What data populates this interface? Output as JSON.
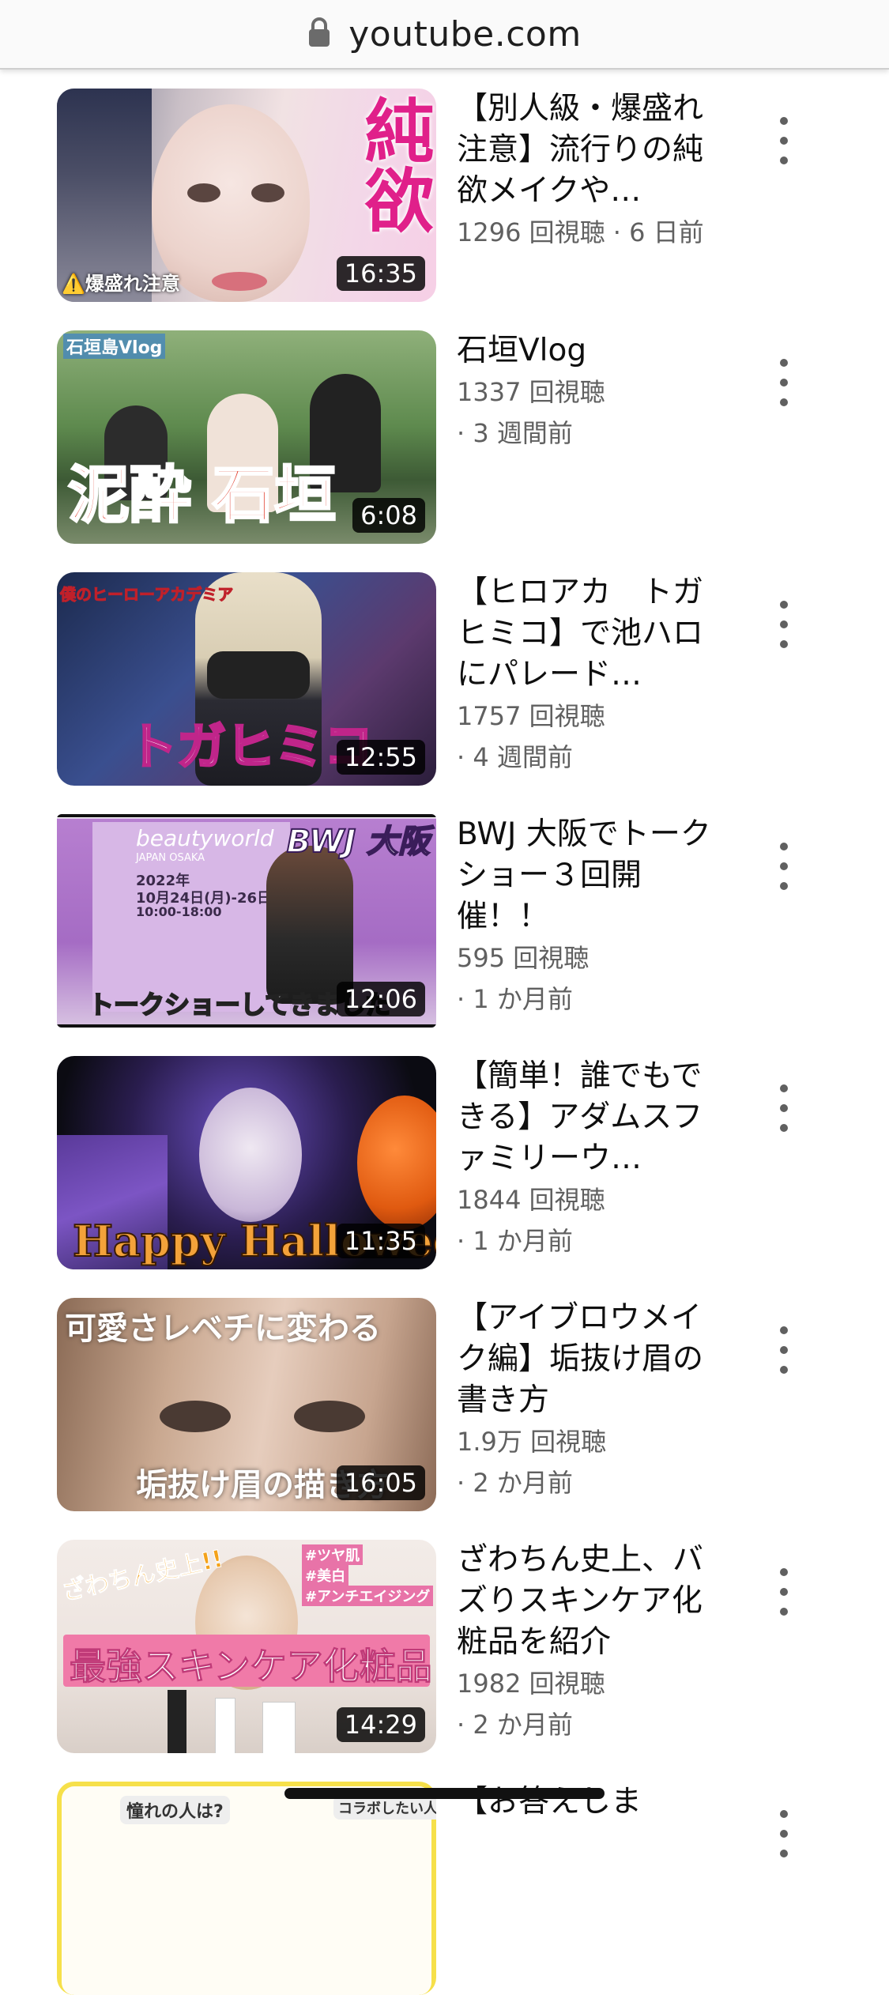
{
  "browser": {
    "url": "youtube.com"
  },
  "videos": [
    {
      "title": "【別人級・爆盛れ注意】流行りの純欲メイクや…",
      "views": "1296 回視聴",
      "age": "6 日前",
      "duration": "16:35",
      "thumb_text_1": "純欲",
      "thumb_text_2": "⚠️爆盛れ注意"
    },
    {
      "title": "石垣Vlog",
      "views": "1337 回視聴",
      "age": "· 3 週間前",
      "duration": "6:08",
      "thumb_text_1": "泥酔 石垣",
      "thumb_text_2": "石垣島Vlog"
    },
    {
      "title": "【ヒロアカ　トガヒミコ】で池ハロにパレード…",
      "views": "1757 回視聴",
      "age": "· 4 週間前",
      "duration": "12:55",
      "thumb_text_1": "トガヒミコ",
      "thumb_text_2": "僕のヒーローアカデミア"
    },
    {
      "title": "BWJ 大阪でトークショー３回開催！！",
      "views": "595 回視聴",
      "age": "· 1 か月前",
      "duration": "12:06",
      "thumb_text_1": "BWJ 大阪",
      "thumb_text_2": "トークショーしてきました",
      "thumb_text_3": "beautyworld",
      "thumb_text_4": "JAPAN OSAKA",
      "thumb_text_5": "2022年",
      "thumb_text_6": "10月24日(月)-26日(水)",
      "thumb_text_7": "10:00-18:00"
    },
    {
      "title": "【簡単！誰でもできる】アダムスファミリーウ…",
      "views": "1844 回視聴",
      "age": "· 1 か月前",
      "duration": "11:35",
      "thumb_text_1": "Happy Halloween"
    },
    {
      "title": "【アイブロウメイク編】垢抜け眉の書き方",
      "views": "1.9万 回視聴",
      "age": "· 2 か月前",
      "duration": "16:05",
      "thumb_text_1": "可愛さレベチに変わる",
      "thumb_text_2": "垢抜け眉の描き方"
    },
    {
      "title": "ざわちん史上、バズりスキンケア化粧品を紹介",
      "views": "1982 回視聴",
      "age": "· 2 か月前",
      "duration": "14:29",
      "thumb_text_1": "最強スキンケア化粧品",
      "thumb_text_2": "ざわちん史上!!",
      "thumb_text_3": "#ツヤ肌",
      "thumb_text_4": "#美白",
      "thumb_text_5": "#アンチエイジング"
    },
    {
      "title": "【お答えしま",
      "thumb_text_1": "憧れの人は?",
      "thumb_text_2": "コラボしたい人は?"
    }
  ],
  "colors": {
    "meta_text": "#606060",
    "title_text": "#0f0f0f",
    "duration_bg": "#000000"
  },
  "icons": [
    "lock-icon",
    "more-vert-icon"
  ]
}
